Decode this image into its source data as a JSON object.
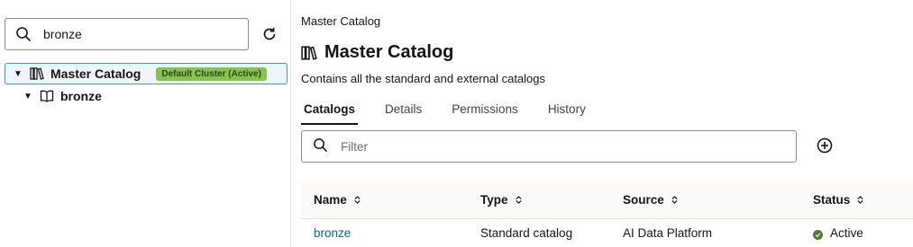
{
  "left_panel": {
    "search": {
      "value": "bronze"
    },
    "tree": [
      {
        "label": "Master Catalog",
        "badge": "Default Cluster (Active)"
      },
      {
        "label": "bronze"
      }
    ]
  },
  "main": {
    "breadcrumb": "Master Catalog",
    "title": "Master Catalog",
    "subtitle": "Contains all the standard and external catalogs",
    "tabs": [
      {
        "label": "Catalogs",
        "active": true
      },
      {
        "label": "Details"
      },
      {
        "label": "Permissions"
      },
      {
        "label": "History"
      }
    ],
    "filter": {
      "placeholder": "Filter"
    },
    "table": {
      "columns": [
        "Name",
        "Type",
        "Source",
        "Status"
      ],
      "rows": [
        {
          "name": "bronze",
          "type": "Standard catalog",
          "source": "AI Data Platform",
          "status": "Active"
        }
      ]
    }
  },
  "colors": {
    "badge_bg": "#8bc34a",
    "link": "#00688c",
    "status_active": "#4f7d2b",
    "selected_border": "#3a9bd9"
  },
  "icons": [
    "search-icon",
    "refresh-icon",
    "catalog-icon",
    "book-icon",
    "add-circle-icon",
    "sort-icon",
    "check-icon"
  ]
}
